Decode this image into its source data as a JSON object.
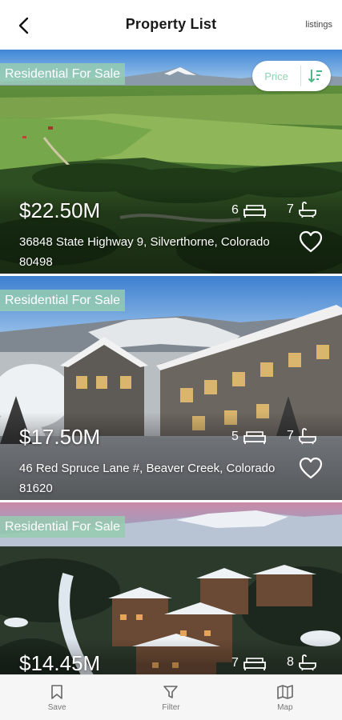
{
  "header": {
    "title": "Property List",
    "listings_link": "listings",
    "back_icon": "chevron-left-icon"
  },
  "sort": {
    "label": "Price",
    "icon": "sort-descending-icon",
    "accent_color": "#4bb88a"
  },
  "listings": [
    {
      "badge": "Residential For Sale",
      "price": "$22.50M",
      "beds": "6",
      "baths": "7",
      "address": "36848 State Highway 9, Silverthorne, Colorado 80498"
    },
    {
      "badge": "Residential For Sale",
      "price": "$17.50M",
      "beds": "5",
      "baths": "7",
      "address": "46 Red Spruce Lane #, Beaver Creek, Colorado 81620"
    },
    {
      "badge": "Residential For Sale",
      "price": "$14.45M",
      "beds": "7",
      "baths": "8",
      "address": ""
    }
  ],
  "bottom_nav": [
    {
      "label": "Save",
      "icon": "bookmark-icon"
    },
    {
      "label": "Filter",
      "icon": "filter-icon"
    },
    {
      "label": "Map",
      "icon": "map-icon"
    }
  ]
}
